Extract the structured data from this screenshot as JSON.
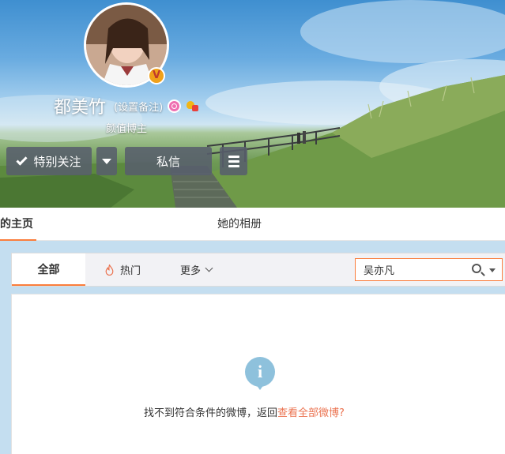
{
  "profile": {
    "name": "都美竹",
    "remark_link": "(设置备注)",
    "subtitle": "颜值博主",
    "verified_badge": "V",
    "icons": [
      "pink-search-badge-icon",
      "gold-member-icon"
    ]
  },
  "actions": {
    "follow_label": "特别关注",
    "message_label": "私信"
  },
  "tabs": {
    "home_label": "的主页",
    "album_label": "她的相册"
  },
  "filter": {
    "all_label": "全部",
    "hot_label": "热门",
    "more_label": "更多",
    "search_value": "吴亦凡"
  },
  "empty_state": {
    "message": "找不到符合条件的微博，返回",
    "link_text": "查看全部微博?",
    "icon_glyph": "i"
  },
  "colors": {
    "accent": "#fa7d3c",
    "link": "#eb7350",
    "info_icon": "#8ec1dc",
    "page_bg": "#c4def0"
  }
}
